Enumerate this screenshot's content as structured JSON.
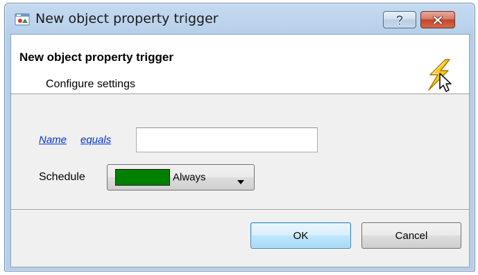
{
  "window": {
    "title": "New object property trigger",
    "icon": "window-app-icon",
    "buttons": {
      "help": "help-icon",
      "close": "close-icon"
    }
  },
  "header": {
    "title": "New object property trigger",
    "subtitle": "Configure settings",
    "icon": "lightning-icon"
  },
  "form": {
    "name_link": "Name",
    "operator_link": "equals",
    "name_value": "",
    "schedule_label": "Schedule",
    "schedule_value": "Always",
    "schedule_color": "#008000"
  },
  "buttons": {
    "ok": "OK",
    "cancel": "Cancel"
  },
  "colors": {
    "link": "#0033cc",
    "titlebar": "#bcd4ec"
  }
}
